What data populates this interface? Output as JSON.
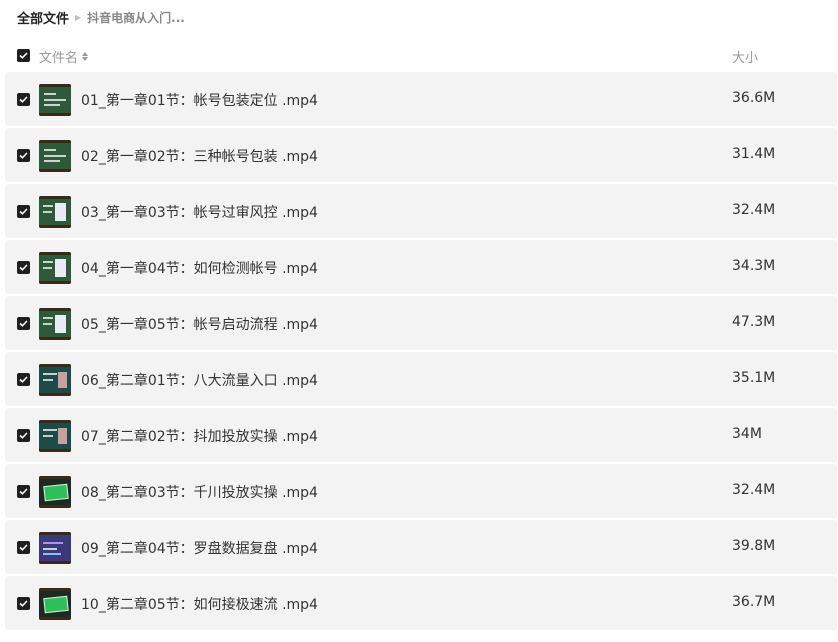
{
  "breadcrumb": {
    "root": "全部文件",
    "current": "抖音电商从入门..."
  },
  "header": {
    "name_label": "文件名",
    "size_label": "大小"
  },
  "colors": {
    "row_bg": "#f3f3f3",
    "checkbox": "#1f1f1f",
    "chalkboard_green": "#2f5a3a",
    "chalkboard_teal": "#1e4a48",
    "chalkboard_purple": "#3a3a7a"
  },
  "files": [
    {
      "name": "01_第一章01节：帐号包装定位 .mp4",
      "size": "36.6M",
      "thumb": "green",
      "checked": true
    },
    {
      "name": "02_第一章02节：三种帐号包装 .mp4",
      "size": "31.4M",
      "thumb": "green",
      "checked": true
    },
    {
      "name": "03_第一章03节：帐号过审风控 .mp4",
      "size": "32.4M",
      "thumb": "green-card",
      "checked": true
    },
    {
      "name": "04_第一章04节：如何检测帐号 .mp4",
      "size": "34.3M",
      "thumb": "green-card",
      "checked": true
    },
    {
      "name": "05_第一章05节：帐号启动流程 .mp4",
      "size": "47.3M",
      "thumb": "green-card",
      "checked": true
    },
    {
      "name": "06_第二章01节：八大流量入口 .mp4",
      "size": "35.1M",
      "thumb": "teal",
      "checked": true
    },
    {
      "name": "07_第二章02节：抖加投放实操 .mp4",
      "size": "34M",
      "thumb": "teal",
      "checked": true
    },
    {
      "name": "08_第二章03节：千川投放实操 .mp4",
      "size": "32.4M",
      "thumb": "dark-badge",
      "checked": true
    },
    {
      "name": "09_第二章04节：罗盘数据复盘 .mp4",
      "size": "39.8M",
      "thumb": "purple",
      "checked": true
    },
    {
      "name": "10_第二章05节：如何接极速流 .mp4",
      "size": "36.7M",
      "thumb": "dark-badge",
      "checked": true
    }
  ]
}
